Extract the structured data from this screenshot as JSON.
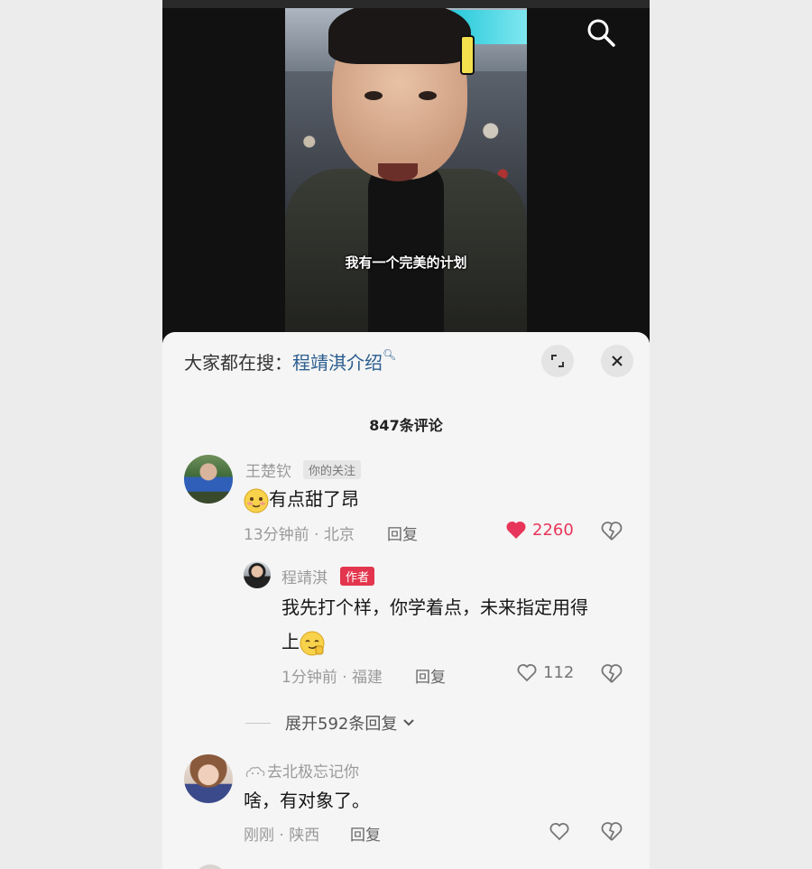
{
  "video": {
    "caption": "我有一个完美的计划"
  },
  "sheet": {
    "search_label": "大家都在搜：",
    "search_term": "程靖淇介绍",
    "comment_count": "847条评论"
  },
  "comments": [
    {
      "username": "王楚钦",
      "follow_tag": "你的关注",
      "text": "有点甜了昂",
      "time_location": "13分钟前 · 北京",
      "reply_label": "回复",
      "likes": "2260",
      "liked": true,
      "replies": [
        {
          "username": "程靖淇",
          "author_tag": "作者",
          "text_line1": "我先打个样，你学着点，未来指定用得",
          "text_line2": "上",
          "time_location": "1分钟前 · 福建",
          "reply_label": "回复",
          "likes": "112"
        }
      ],
      "expand_label": "展开592条回复"
    },
    {
      "username": "去北极忘记你",
      "text": "啥，有对象了。",
      "time_location": "刚刚 · 陕西",
      "reply_label": "回复"
    }
  ],
  "colors": {
    "accent_red": "#e3354d",
    "link_blue": "#2a5d8e",
    "heart": "#e8365a"
  }
}
